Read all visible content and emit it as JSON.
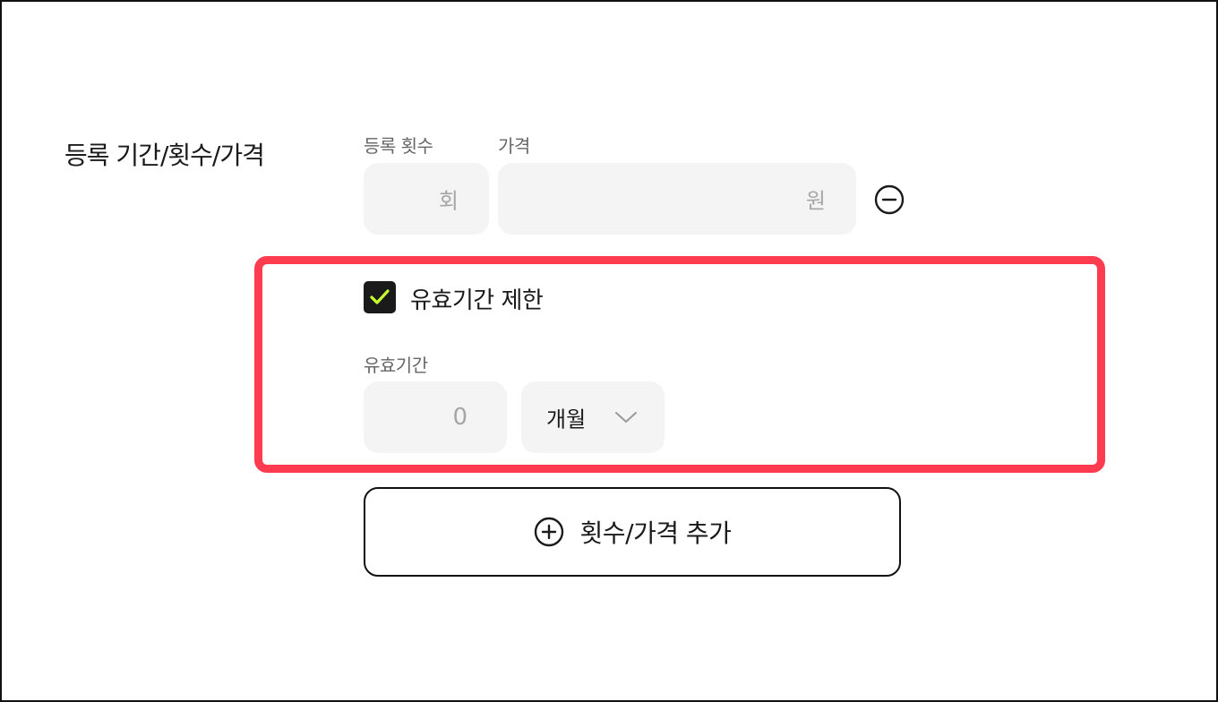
{
  "section": {
    "title": "등록 기간/횟수/가격"
  },
  "count_field": {
    "label": "등록 횟수",
    "value": "",
    "unit": "회"
  },
  "price_field": {
    "label": "가격",
    "value": "",
    "unit": "원"
  },
  "validity": {
    "checkbox_label": "유효기간 제한",
    "checked": true,
    "label": "유효기간",
    "value": "0",
    "period_selected": "개월"
  },
  "add_button": {
    "label": "횟수/가격 추가"
  },
  "colors": {
    "highlight": "#ff3b50",
    "check_mark": "#c8ff2e",
    "field_bg": "#f4f4f4"
  },
  "icons": {
    "remove": "minus-circle-icon",
    "add": "plus-circle-icon",
    "dropdown": "chevron-down-icon",
    "check": "checkmark-icon"
  }
}
